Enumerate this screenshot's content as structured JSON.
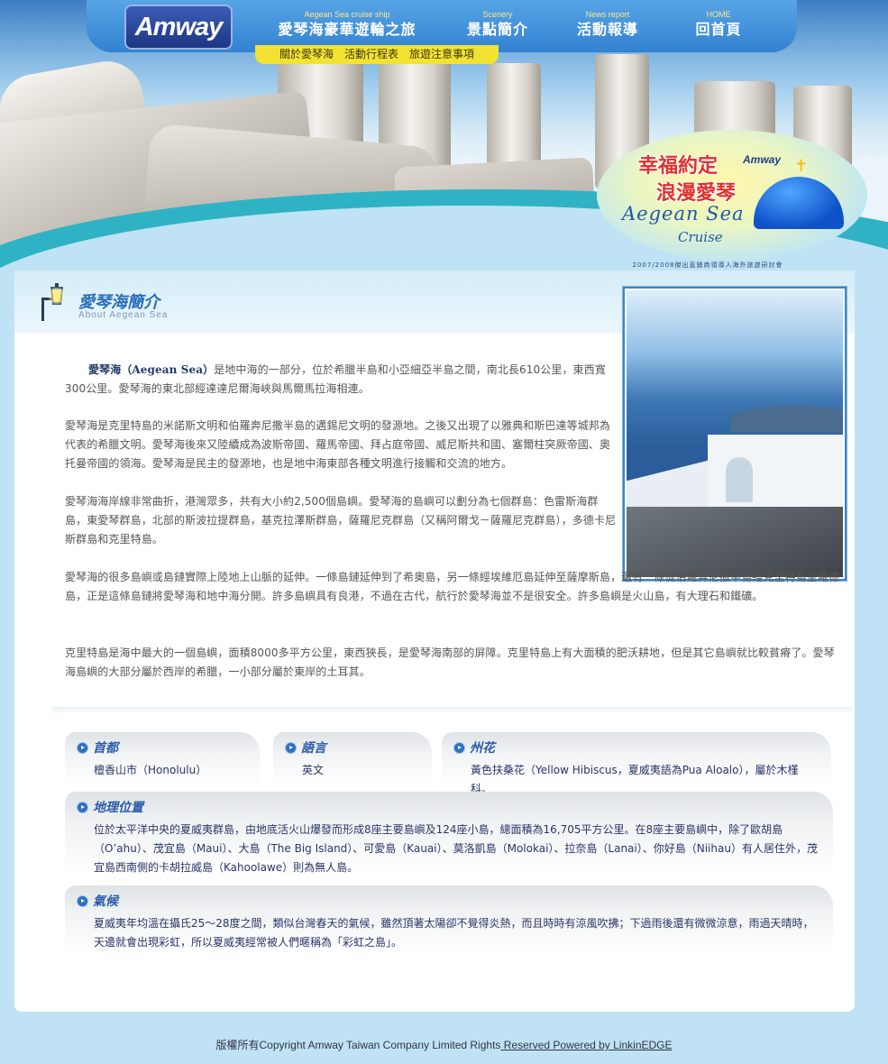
{
  "header": {
    "logo": "Amway",
    "nav": [
      {
        "sub": "Aegean Sea  cruise ship",
        "label": "愛琴海豪華遊輪之旅"
      },
      {
        "sub": "Scenery",
        "label": "景點簡介"
      },
      {
        "sub": "News report",
        "label": "活動報導"
      },
      {
        "sub": "HOME",
        "label": "回首頁"
      }
    ],
    "subnav": [
      "關於愛琴海",
      "活動行程表",
      "旅遊注意事項"
    ],
    "badge": {
      "line1": "幸福約定",
      "line2": "浪漫愛琴",
      "brand": "Amway",
      "aegean": "Aegean Sea",
      "cruise": "Cruise",
      "caption": "2007/2008傑出直銷商領導人海外旅遊研討會"
    }
  },
  "section": {
    "title": "愛琴海簡介",
    "subtitle": "About Aegean Sea"
  },
  "paragraphs": {
    "p1_lead": "愛琴海（Aegean Sea）",
    "p1": "是地中海的一部分，位於希臘半島和小亞細亞半島之間，南北長610公里，東西寬300公里。愛琴海的東北部經達達尼爾海峽與馬爾馬拉海相連。",
    "p2": "愛琴海是克里特島的米諾斯文明和伯羅奔尼撒半島的邁錫尼文明的發源地。之後又出現了以雅典和斯巴達等城邦為代表的希臘文明。愛琴海後來又陸續成為波斯帝國、羅馬帝國、拜占庭帝國、威尼斯共和國、塞爾柱突厥帝國、奧托曼帝國的領海。愛琴海是民主的發源地，也是地中海東部各種文明進行接觸和交流的地方。",
    "p3": "愛琴海海岸線非常曲折，港灣眾多，共有大小約2,500個島嶼。愛琴海的島嶼可以劃分為七個群島：色雷斯海群島，東愛琴群島，北部的斯波拉提群島，基克拉澤斯群島，薩羅尼克群島（又稱阿爾戈－薩羅尼克群島），多德卡尼斯群島和克里特島。",
    "p4": "愛琴海的很多島嶼或島鏈實際上陸地上山脈的延伸。一條島鏈延伸到了希奧島，另一條經埃維厄島延伸至薩摩斯島，還有一條從伯羅奔尼撒半島經克里特島至羅德島，正是這條島鏈將愛琴海和地中海分開。許多島嶼具有良港，不過在古代，航行於愛琴海並不是很安全。許多島嶼是火山島，有大理石和鐵礦。",
    "p5": "克里特島是海中最大的一個島嶼，面積8000多平方公里，東西狹長，是愛琴海南部的屏障。克里特島上有大面積的肥沃耕地，但是其它島嶼就比較貧瘠了。愛琴海島嶼的大部分屬於西岸的希臘，一小部分屬於東岸的土耳其。"
  },
  "info": {
    "capital": {
      "title": "首都",
      "body": "檀香山市（Honolulu）"
    },
    "language": {
      "title": "語言",
      "body": "英文"
    },
    "flower": {
      "title": "州花",
      "body": "黃色扶桑花（Yellow Hibiscus，夏威夷語為Pua Aloalo），屬於木槿科。"
    },
    "geography": {
      "title": "地理位置",
      "body": "位於太平洋中央的夏威夷群島，由地底活火山爆發而形成8座主要島嶼及124座小島，總面積為16,705平方公里。在8座主要島嶼中，除了歐胡島（O’ahu）、茂宜島（Maui）、大島（The Big Island）、可愛島（Kauai）、莫洛凱島（Molokai）、拉奈島（Lanai）、你好島（Niihau）有人居住外，茂宜島西南側的卡胡拉威島（Kahoolawe）則為無人島。"
    },
    "climate": {
      "title": "氣候",
      "body": "夏威夷年均溫在攝氏25～28度之間，類似台灣春天的氣候，雖然頂著太陽卻不覺得炎熱，而且時時有涼風吹拂；下過雨後還有微微涼意，雨過天晴時，天邊就會出現彩虹，所以夏威夷經常被人們暱稱為「彩虹之島」。"
    }
  },
  "footer": {
    "text": "版權所有Copyright Amway Taiwan Company Limited Rights",
    "link": " Reserved Powered by LinkinEDGE"
  },
  "colors": {
    "accent": "#2a6fb7",
    "subnav": "#f4e232",
    "nav": "#3b8bd8",
    "badge_text": "#e2312d"
  }
}
